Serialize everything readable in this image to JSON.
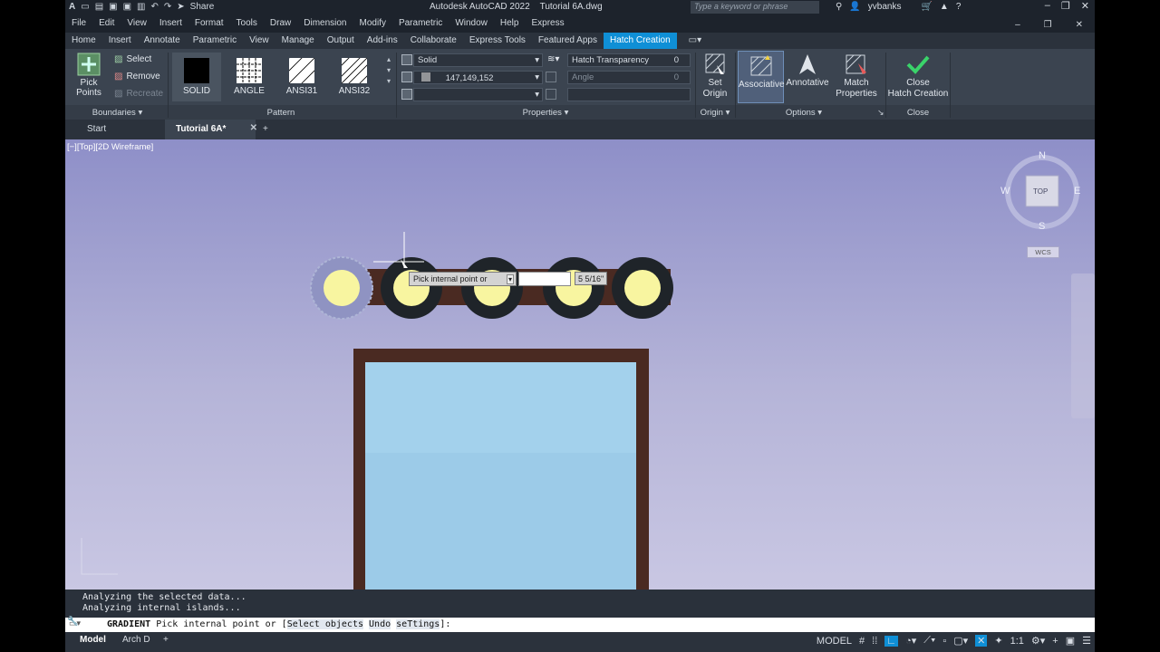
{
  "titlebar": {
    "app_title": "Autodesk AutoCAD 2022",
    "doc_title": "Tutorial 6A.dwg",
    "share_label": "Share",
    "search_placeholder": "Type a keyword or phrase",
    "user": "yvbanks"
  },
  "menubar": {
    "items": [
      "File",
      "Edit",
      "View",
      "Insert",
      "Format",
      "Tools",
      "Draw",
      "Dimension",
      "Modify",
      "Parametric",
      "Window",
      "Help",
      "Express"
    ]
  },
  "ribbon_tabs": {
    "items": [
      "Home",
      "Insert",
      "Annotate",
      "Parametric",
      "View",
      "Manage",
      "Output",
      "Add-ins",
      "Collaborate",
      "Express Tools",
      "Featured Apps",
      "Hatch Creation"
    ],
    "active_index": 11
  },
  "ribbon": {
    "pick_points": "Pick Points",
    "select": "Select",
    "remove": "Remove",
    "recreate": "Recreate",
    "patterns": [
      "SOLID",
      "ANGLE",
      "ANSI31",
      "ANSI32"
    ],
    "hatch_type": "Solid",
    "hatch_color": "147,149,152",
    "transparency_label": "Hatch Transparency",
    "transparency_value": "0",
    "angle_label": "Angle",
    "angle_value": "0",
    "set_origin": "Set\nOrigin",
    "associative": "Associative",
    "annotative": "Annotative",
    "match_properties": "Match\nProperties",
    "close_hatch": "Close\nHatch Creation",
    "panel_titles": {
      "boundaries": "Boundaries",
      "pattern": "Pattern",
      "properties": "Properties",
      "origin": "Origin",
      "options": "Options",
      "close": "Close"
    }
  },
  "doc_tabs": {
    "start": "Start",
    "current": "Tutorial 6A*"
  },
  "canvas": {
    "view_label": "[−][Top][2D Wireframe]",
    "tooltip": "Pick internal point or",
    "dim_value": "5 5/16\"",
    "viewcube": {
      "n": "N",
      "s": "S",
      "e": "E",
      "w": "W",
      "top": "TOP",
      "wcs": "WCS"
    }
  },
  "command": {
    "history": [
      "Analyzing the selected data...",
      "Analyzing internal islands..."
    ],
    "prompt_cmd": "GRADIENT",
    "prompt_text": "Pick internal point or [",
    "options": [
      "Select objects",
      "Undo",
      "seTtings"
    ],
    "prompt_end": "]:"
  },
  "status": {
    "tabs": [
      "Model",
      "Arch D"
    ],
    "model_label": "MODEL",
    "scale": "1:1"
  },
  "colors": {
    "accent": "#0f8fd6",
    "wall": "#4a2a22",
    "window_glass": "#9ccbe8",
    "circle_fill": "#f8f5a0",
    "circle_ring": "#1f2429"
  }
}
